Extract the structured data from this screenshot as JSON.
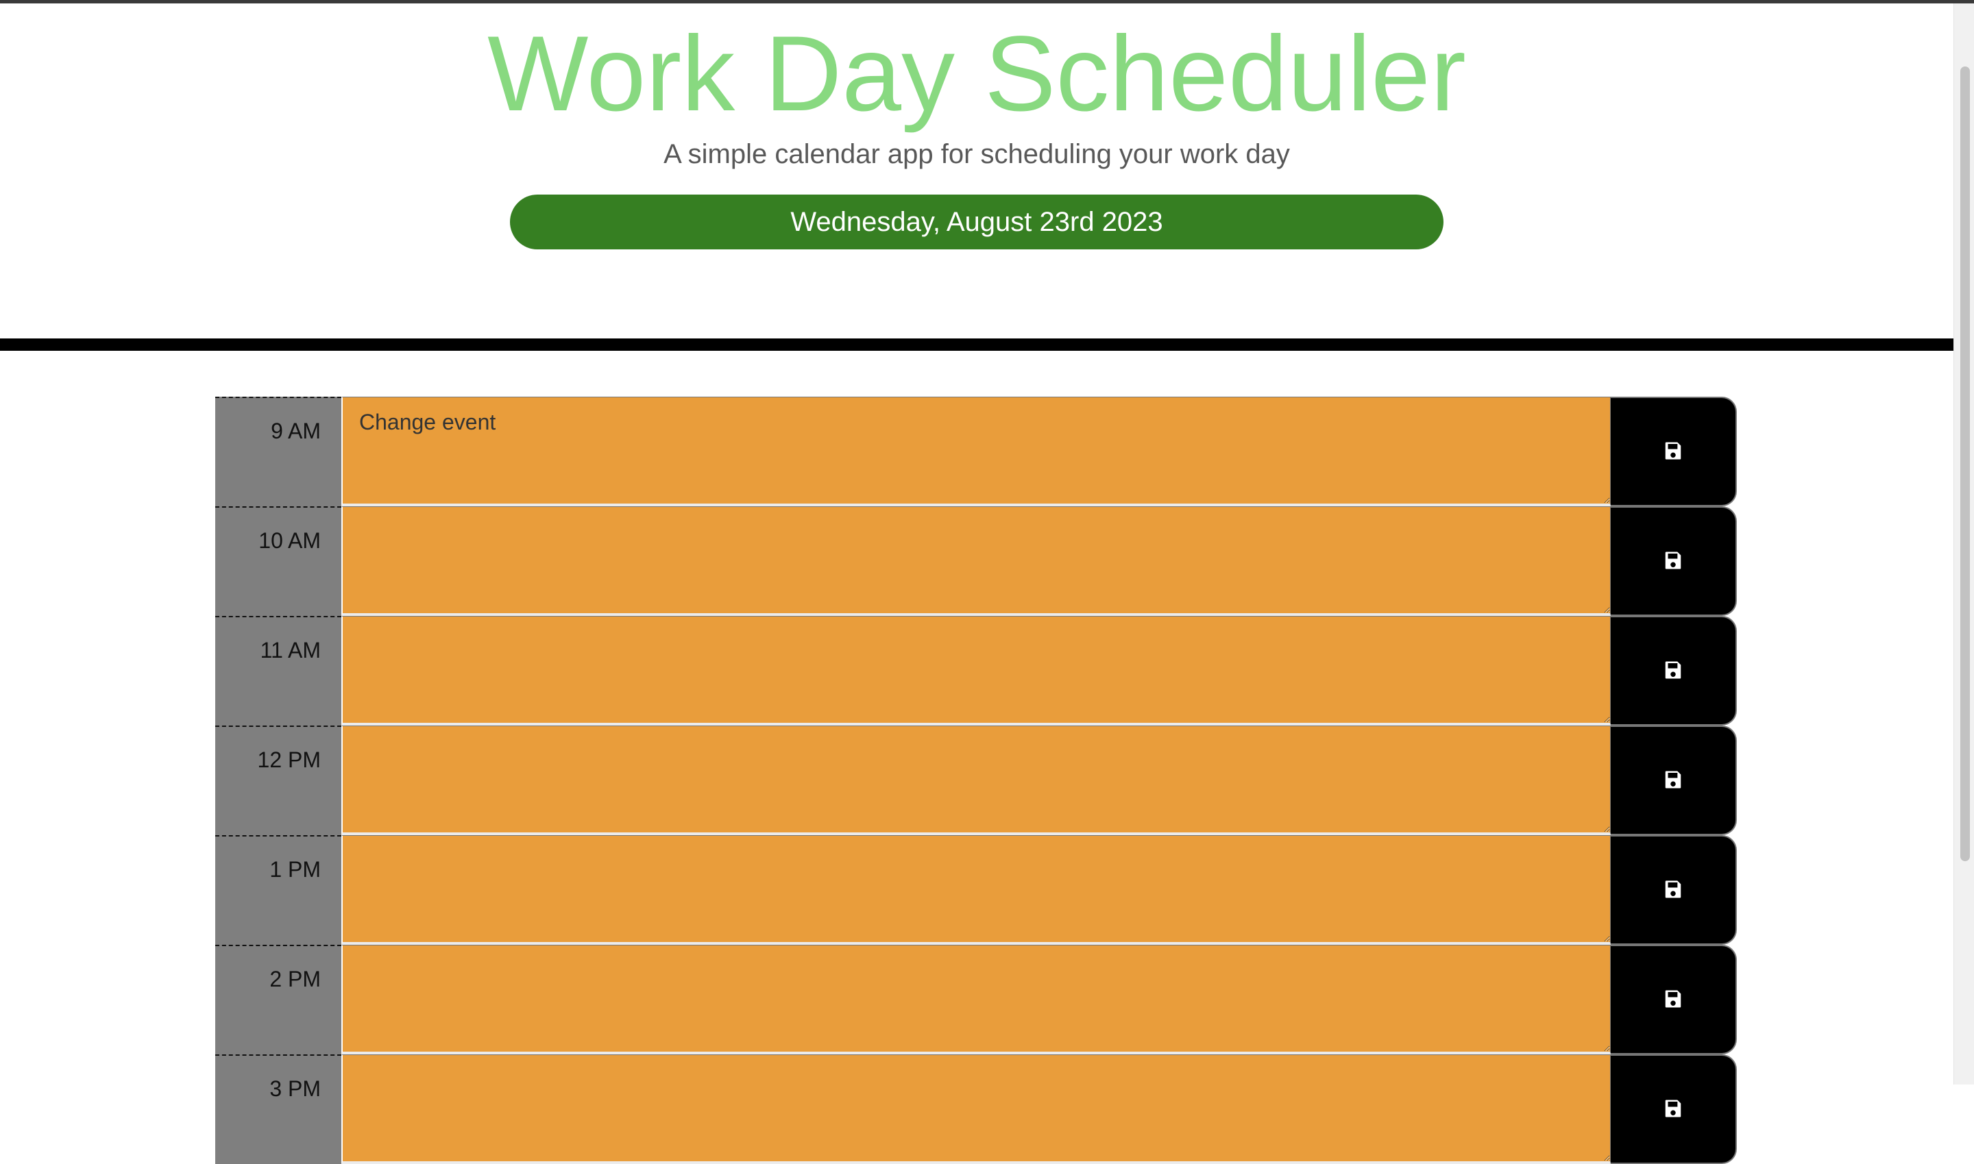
{
  "header": {
    "title": "Work Day Scheduler",
    "subtitle": "A simple calendar app for scheduling your work day",
    "current_date": "Wednesday, August 23rd 2023"
  },
  "rows": [
    {
      "hour": "9 AM",
      "event": "Change event"
    },
    {
      "hour": "10 AM",
      "event": ""
    },
    {
      "hour": "11 AM",
      "event": ""
    },
    {
      "hour": "12 PM",
      "event": ""
    },
    {
      "hour": "1 PM",
      "event": ""
    },
    {
      "hour": "2 PM",
      "event": ""
    },
    {
      "hour": "3 PM",
      "event": ""
    }
  ],
  "colors": {
    "title": "#88d980",
    "date_pill": "#367f22",
    "present_row": "#e99d3b",
    "hour_cell": "#7f7f7f",
    "save_button": "#000000"
  },
  "icons": {
    "save": "floppy-disk-icon"
  }
}
